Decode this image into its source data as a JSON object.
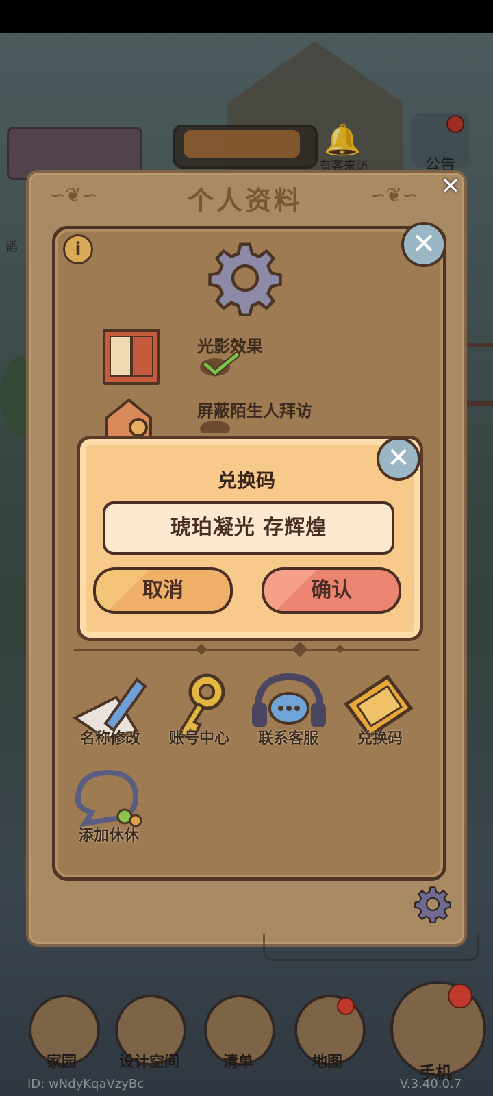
{
  "hud": {
    "visitor_label": "有客来访",
    "notice_label": "公告",
    "side_label": "鹊"
  },
  "profile": {
    "title": "个人资料"
  },
  "settings": {
    "options": [
      {
        "label": "光影效果",
        "checked": true
      },
      {
        "label": "屏蔽陌生人拜访",
        "checked": true
      }
    ],
    "actions": [
      {
        "label": "名称修改",
        "icon": "pencil-icon"
      },
      {
        "label": "账号中心",
        "icon": "key-icon"
      },
      {
        "label": "联系客服",
        "icon": "headset-icon"
      },
      {
        "label": "兑换码",
        "icon": "ticket-icon"
      },
      {
        "label": "添加休休",
        "icon": "chat-bubble-icon"
      }
    ]
  },
  "redeem": {
    "title": "兑换码",
    "code_value": "琥珀凝光  存辉煌",
    "cancel_label": "取消",
    "confirm_label": "确认"
  },
  "bottom_nav": {
    "items": [
      {
        "label": "家园"
      },
      {
        "label": "设计空间"
      },
      {
        "label": "清单"
      },
      {
        "label": "地图"
      },
      {
        "label": "手机"
      }
    ]
  },
  "footer": {
    "user_id": "ID: wNdyKqaVzyBc",
    "version": "V.3.40.0.7"
  },
  "colors": {
    "panel": "#a88a64",
    "dialog": "#f7c98a",
    "confirm": "#ec8472",
    "cancel": "#efb06a"
  }
}
